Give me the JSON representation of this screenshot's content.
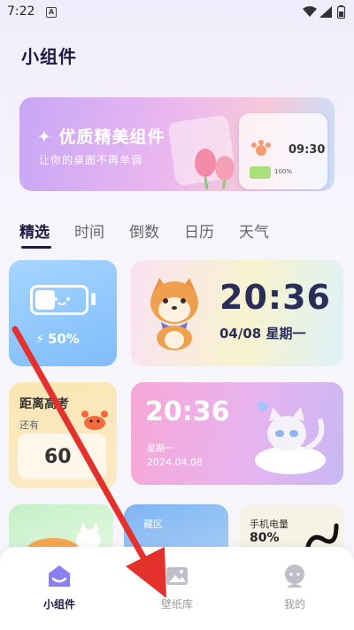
{
  "status_bar": {
    "time": "7:22",
    "notification_letter": "A"
  },
  "page": {
    "title": "小组件"
  },
  "banner": {
    "title": "✦ 优质精美组件",
    "subtitle": "让你的桌面不再单调",
    "preview_time": "09:30",
    "preview_battery": "100%"
  },
  "tabs": [
    {
      "label": "精选",
      "active": true
    },
    {
      "label": "时间",
      "active": false
    },
    {
      "label": "倒数",
      "active": false
    },
    {
      "label": "日历",
      "active": false
    },
    {
      "label": "天气",
      "active": false
    }
  ],
  "widgets": {
    "battery": {
      "percent": "50%"
    },
    "clock1": {
      "time": "20:36",
      "date": "04/08  星期一"
    },
    "exam": {
      "title": "距离高考",
      "sub": "还有",
      "days": "60"
    },
    "clock2": {
      "time": "20:36",
      "weekday": "星期一",
      "date": "2024.04.08"
    },
    "weather": {
      "label": "藏区"
    },
    "phone": {
      "label": "手机电量",
      "percent": "80%"
    }
  },
  "bottom_nav": [
    {
      "label": "小组件",
      "active": true
    },
    {
      "label": "壁纸库",
      "active": false
    },
    {
      "label": "我的",
      "active": false
    }
  ],
  "colors": {
    "accent": "#1d1b44",
    "annotation": "#e5312c"
  }
}
